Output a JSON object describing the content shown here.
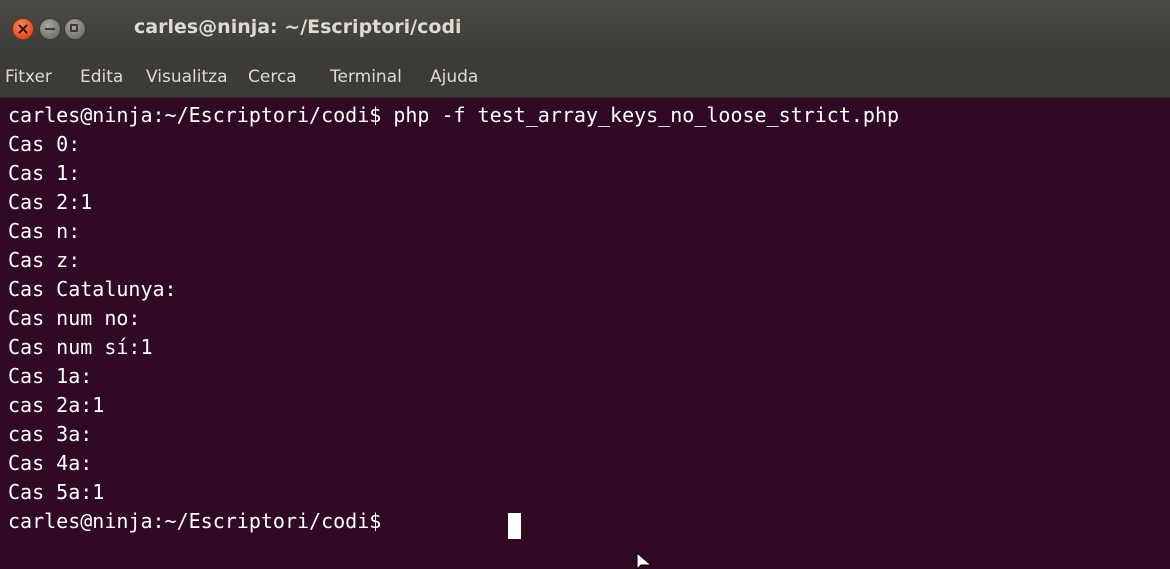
{
  "window": {
    "title": "carles@ninja: ~/Escriptori/codi"
  },
  "menu": {
    "items": [
      "Fitxer",
      "Edita",
      "Visualitza",
      "Cerca",
      "Terminal",
      "Ajuda"
    ]
  },
  "terminal": {
    "lines": [
      "carles@ninja:~/Escriptori/codi$ php -f test_array_keys_no_loose_strict.php",
      "Cas 0:",
      "Cas 1:",
      "Cas 2:1",
      "Cas n:",
      "Cas z:",
      "Cas Catalunya:",
      "Cas num no:",
      "Cas num sí:1",
      "Cas 1a:",
      "cas 2a:1",
      "cas 3a:",
      "Cas 4a:",
      "Cas 5a:1",
      "carles@ninja:~/Escriptori/codi$ "
    ]
  },
  "colors": {
    "terminal_background": "#300a24",
    "terminal_text": "#ffffff",
    "titlebar": "#3c3b37",
    "close_button": "#e2552a"
  },
  "icons": {
    "close": "close-icon",
    "minimize": "minimize-icon",
    "maximize": "maximize-icon",
    "cursor": "mouse-pointer-icon"
  }
}
